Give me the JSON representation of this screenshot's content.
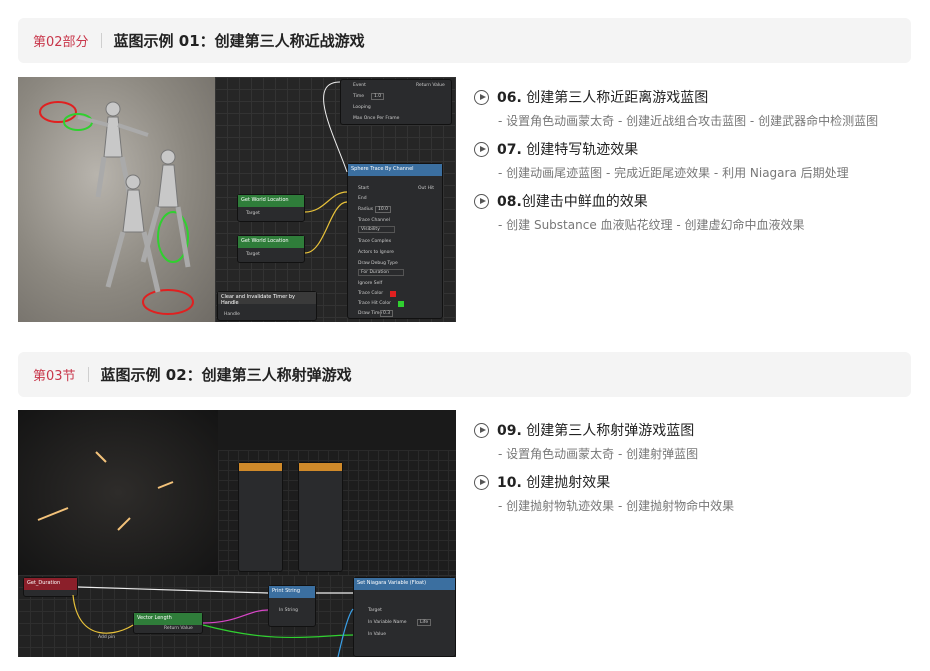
{
  "sections": [
    {
      "tag": "第02部分",
      "title": "蓝图示例 01：创建第三人称近战游戏",
      "items": [
        {
          "num": "06.",
          "title": "创建第三人称近距离游戏蓝图",
          "sub": "- 设置角色动画蒙太奇 - 创建近战组合攻击蓝图 - 创建武器命中检测蓝图"
        },
        {
          "num": "07.",
          "title": "创建特写轨迹效果",
          "sub": "- 创建动画尾迹蓝图 - 完成近距尾迹效果 - 利用 Niagara 后期处理"
        },
        {
          "num": "08.",
          "title": "创建击中鲜血的效果",
          "sub": "- 创建 Substance 血液贴花纹理 - 创建虚幻命中血液效果"
        }
      ]
    },
    {
      "tag": "第03节",
      "title": "蓝图示例 02：创建第三人称射弹游戏",
      "items": [
        {
          "num": "09.",
          "title": "创建第三人称射弹游戏蓝图",
          "sub": "- 设置角色动画蒙太奇 - 创建射弹蓝图"
        },
        {
          "num": "10.",
          "title": "创建抛射效果",
          "sub": "- 创建抛射物轨迹效果 - 创建抛射物命中效果"
        }
      ]
    }
  ],
  "shot1": {
    "event": "Event",
    "return_value": "Return Value",
    "time": "Time",
    "time_val": "1.0",
    "looping": "Looping",
    "max_once": "Max Once Per Frame",
    "sphere_trace": "Sphere Trace By Channel",
    "start": "Start",
    "end": "End",
    "out_hit": "Out Hit",
    "radius": "Radius",
    "radius_val": "10.0",
    "trace_channel": "Trace Channel",
    "visibility": "Visibility",
    "trace_complex": "Trace Complex",
    "actors_ignore": "Actors to Ignore",
    "draw_debug": "Draw Debug Type",
    "none": "For Duration",
    "ignore_self": "Ignore Self",
    "trace_color": "Trace Color",
    "trace_hit_color": "Trace Hit Color",
    "draw_time": "Draw Time",
    "draw_time_val": "0.3",
    "get_world_loc": "Get World Location",
    "target": "Target",
    "clear_timer": "Clear and Invalidate Timer by Handle",
    "handle": "Handle"
  },
  "shot2": {
    "get_duration": "Get_Duration",
    "vector_length": "Vector Length",
    "print_string": "Print String",
    "in_string": "In String",
    "set_niagara": "Set Niagara Variable (Float)",
    "target": "Target",
    "in_variable_name": "In Variable Name",
    "life": "Life",
    "in_value": "In Value",
    "add_pin": "Add pin",
    "return_value": "Return Value"
  }
}
